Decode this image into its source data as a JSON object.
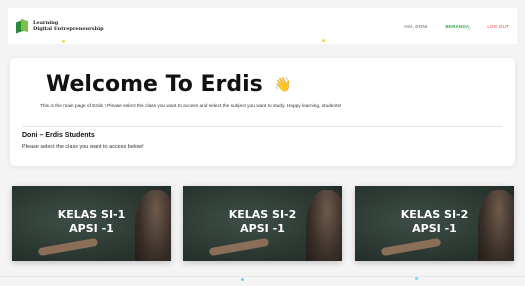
{
  "header": {
    "logo_line1": "Learning",
    "logo_line2": "Digital Entrepreneurship",
    "nav": {
      "user": "HAI, DONI",
      "home": "BERANDA",
      "logout": "LOG OUT"
    }
  },
  "welcome": {
    "title": "Welcome To",
    "brand": "Erdis",
    "wave_icon": "waving-hand",
    "description": "This is the main page of Erdis ! Please select the class you want to access and select the subject you want to study. Happy learning, students!",
    "user_heading": "Doni – Erdis Students",
    "select_prompt": "Please select the class you want to access below!"
  },
  "classes": [
    {
      "line1": "KELAS SI-1",
      "line2": "APSI -1"
    },
    {
      "line1": "KELAS SI-2",
      "line2": "APSI -1"
    },
    {
      "line1": "KELAS SI-2",
      "line2": "APSI -1"
    }
  ],
  "colors": {
    "home_link": "#2fa84f",
    "logout_link": "#e04a3a",
    "chalkboard": "#2c3a33"
  }
}
